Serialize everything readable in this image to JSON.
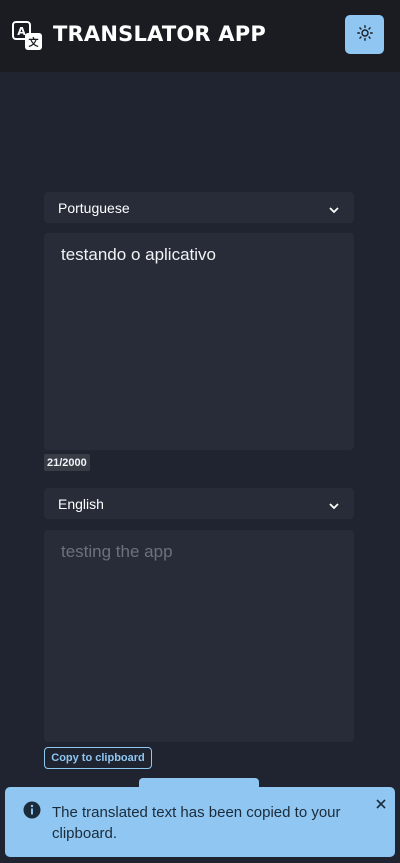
{
  "header": {
    "title": "TRANSLATOR APP",
    "logo_icon": "translate-icon",
    "theme_toggle_icon": "sun-icon"
  },
  "source": {
    "language": "Portuguese",
    "text": "testando o aplicativo",
    "char_count": "21/2000"
  },
  "target": {
    "language": "English",
    "text": "testing the app"
  },
  "actions": {
    "copy_label": "Copy to clipboard"
  },
  "toast": {
    "message": "The translated text has been copied to your clipboard.",
    "icon": "info-icon"
  },
  "colors": {
    "accent": "#8fc7f2",
    "background": "#1f2430",
    "header": "#1a1c22",
    "panel": "#272c38"
  }
}
